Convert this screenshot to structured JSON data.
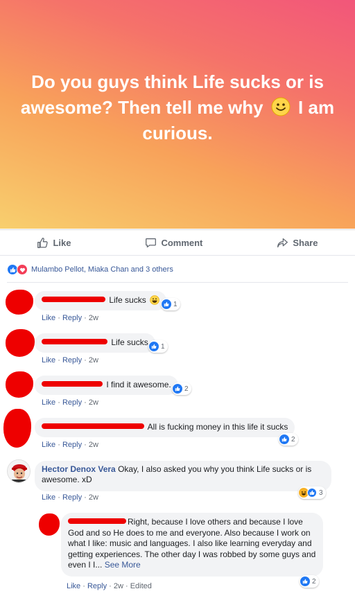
{
  "post": {
    "text_before": "Do you guys think Life sucks or is awesome? Then tell me why",
    "emoji": "smiley-face",
    "text_after": "I am curious."
  },
  "actions": {
    "like": "Like",
    "comment": "Comment",
    "share": "Share"
  },
  "reactions": {
    "summary": "Mulambo Pellot, Miaka Chan and 3 others",
    "types": [
      "like",
      "love"
    ]
  },
  "colors": {
    "link": "#385898",
    "like_blue": "#2078f4",
    "love_red": "#f33e58",
    "redaction": "#e00000"
  },
  "comment_actions": {
    "like": "Like",
    "reply": "Reply",
    "separator": " · "
  },
  "comments": [
    {
      "text": "Life sucks",
      "has_emoji": true,
      "time": "2w",
      "reactions": "1"
    },
    {
      "text": "Life sucks",
      "time": "2w",
      "reactions": "1"
    },
    {
      "text": "I find it awesome.",
      "time": "2w",
      "reactions": "2"
    },
    {
      "text": "All is fucking money in this life it sucks",
      "time": "2w",
      "reactions": "2"
    },
    {
      "name": "Hector Denox Vera",
      "text": "Okay, I also asked you why you think Life sucks or is awesome. xD",
      "time": "2w",
      "reactions": "3"
    }
  ],
  "reply": {
    "text": "Right, because I love others and because I love God and so He does to me and everyone. Also because I work on what I like: music and languages. I also like learning everyday and getting experiences. The other day I was robbed by some guys and even I I...",
    "see_more": "See More",
    "time": "2w",
    "edited": "Edited",
    "reactions": "2"
  }
}
